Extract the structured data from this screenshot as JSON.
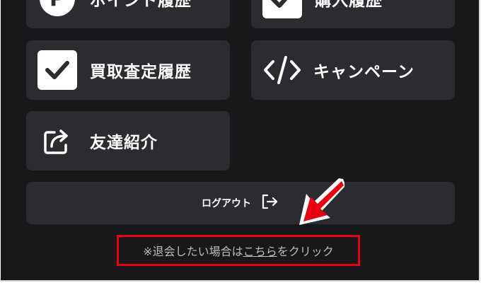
{
  "menu": {
    "point_history_label": "ポイント履歴",
    "purchase_history_label": "購入履歴",
    "buyback_history_label": "買取査定履歴",
    "campaign_label": "キャンペーン",
    "referral_label": "友達紹介"
  },
  "logout": {
    "label": "ログアウト"
  },
  "notice": {
    "prefix": "※退会したい場合は",
    "link_text": "こちら",
    "suffix": "をクリック"
  },
  "colors": {
    "background": "#18181a",
    "tile": "#2b2c2f",
    "text": "#ffffff",
    "notice_text": "#bdbdbd",
    "highlight": "#e60012"
  },
  "icons": {
    "point_history": "point-p-icon",
    "purchase_history": "checkbox-icon",
    "buyback_history": "checkbox-icon",
    "campaign": "code-icon",
    "referral": "share-icon",
    "logout": "logout-arrow-icon"
  }
}
